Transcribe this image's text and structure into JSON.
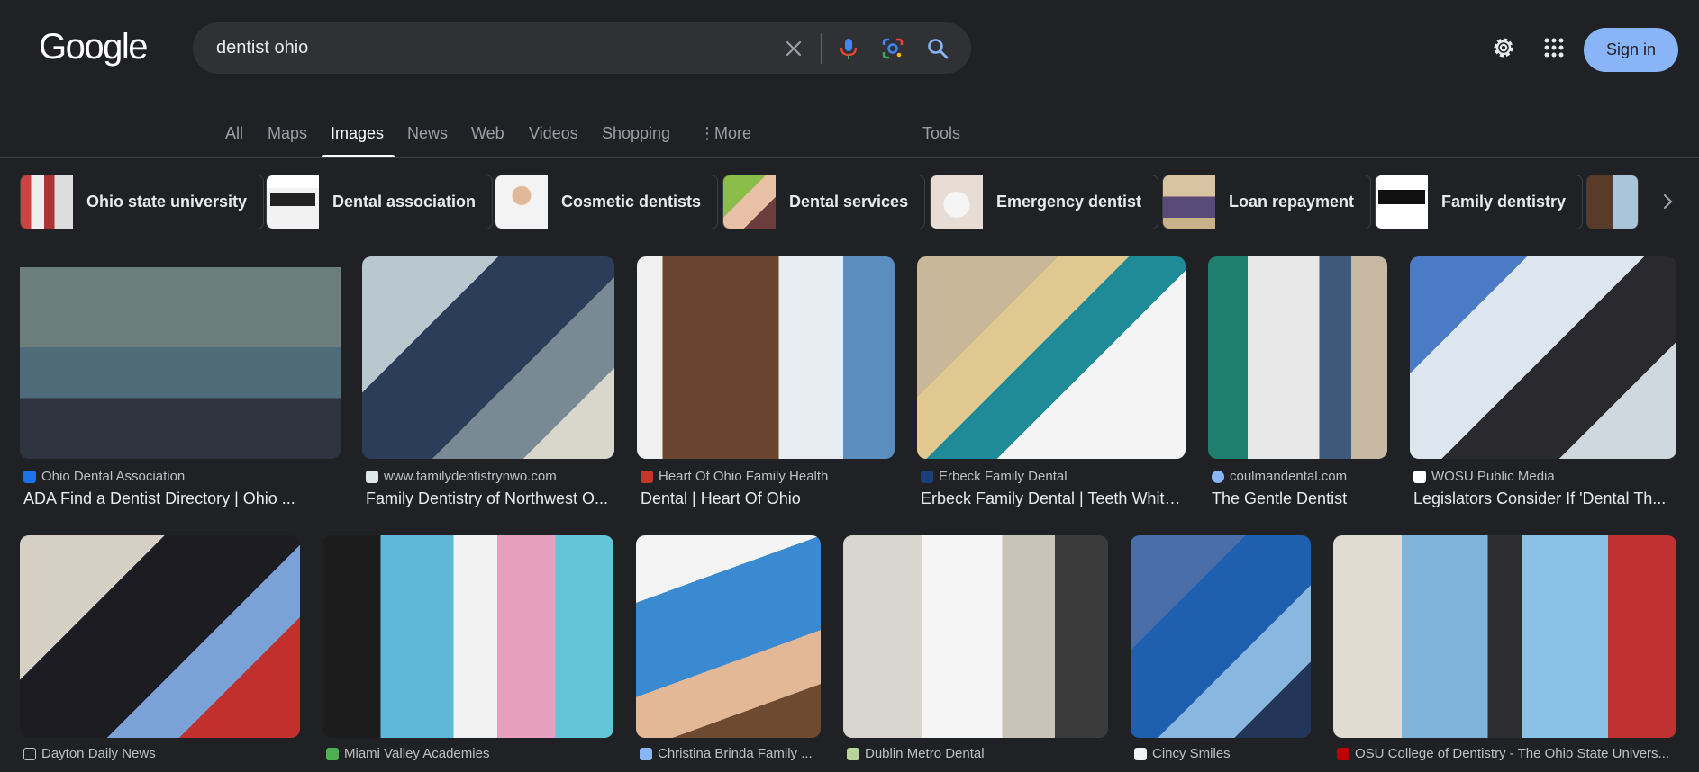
{
  "logo": "Google",
  "search": {
    "query": "dentist ohio"
  },
  "header": {
    "signin_label": "Sign in"
  },
  "tabs": [
    {
      "label": "All"
    },
    {
      "label": "Maps"
    },
    {
      "label": "Images"
    },
    {
      "label": "News"
    },
    {
      "label": "Web"
    },
    {
      "label": "Videos"
    },
    {
      "label": "Shopping"
    },
    {
      "label": "More"
    },
    {
      "label": "Tools"
    }
  ],
  "chips": [
    {
      "label": "Ohio state university"
    },
    {
      "label": "Dental association"
    },
    {
      "label": "Cosmetic dentists"
    },
    {
      "label": "Dental services"
    },
    {
      "label": "Emergency dentist"
    },
    {
      "label": "Loan repayment"
    },
    {
      "label": "Family dentistry"
    }
  ],
  "row1": [
    {
      "source": "Ohio Dental Association",
      "title": "ADA Find a Dentist Directory | Ohio ..."
    },
    {
      "source": "www.familydentistrynwo.com",
      "title": "Family Dentistry of Northwest O..."
    },
    {
      "source": "Heart Of Ohio Family Health",
      "title": "Dental | Heart Of Ohio"
    },
    {
      "source": "Erbeck Family Dental",
      "title": "Erbeck Family Dental | Teeth White..."
    },
    {
      "source": "coulmandental.com",
      "title": "The Gentle Dentist"
    },
    {
      "source": "WOSU Public Media",
      "title": "Legislators Consider If 'Dental Th..."
    }
  ],
  "row2": [
    {
      "source": "Dayton Daily News"
    },
    {
      "source": "Miami Valley Academies"
    },
    {
      "source": "Christina Brinda Family ..."
    },
    {
      "source": "Dublin Metro Dental"
    },
    {
      "source": "Cincy Smiles"
    },
    {
      "source": "OSU College of Dentistry - The Ohio State Univers..."
    }
  ],
  "colors": {
    "background": "#202124",
    "accent": "#8ab4f8",
    "text": "#e8eaed",
    "muted": "#9aa0a6"
  }
}
